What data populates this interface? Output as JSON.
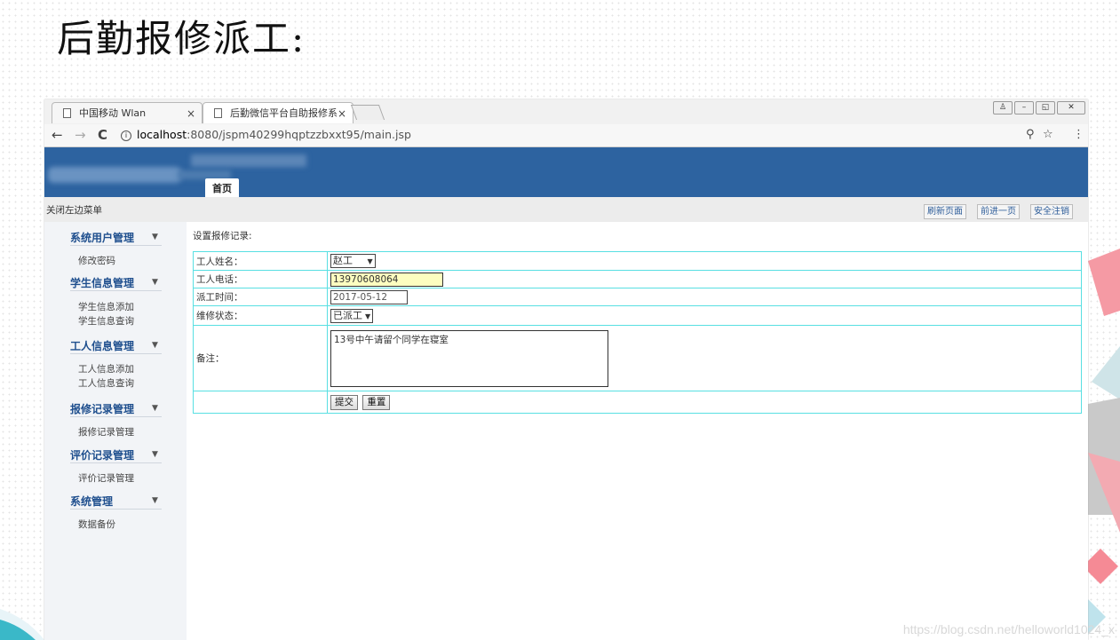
{
  "slide": {
    "title": "后勤报修派工:",
    "watermark": "https://blog.csdn.net/helloworld1024_x"
  },
  "browser": {
    "tabs": [
      {
        "label": "中国移动 Wlan",
        "close": "×"
      },
      {
        "label": "后勤微信平台自助报修系",
        "close": "×"
      }
    ],
    "window_buttons": [
      "♙",
      "–",
      "◱",
      "✕"
    ],
    "nav": {
      "back": "←",
      "forward": "→",
      "reload": "C"
    },
    "url_host": "localhost",
    "url_path": ":8080/jspm40299hqptzzbxxt95/main.jsp",
    "address_icons": {
      "key": "⚲",
      "star": "☆",
      "menu": "⋮"
    }
  },
  "app": {
    "home_tab": "首页",
    "collapse_menu": "关闭左边菜单",
    "toolbar_buttons": [
      "刷新页面",
      "前进一页",
      "安全注销"
    ],
    "sidebar": [
      {
        "group": "系统用户管理",
        "items": [
          "修改密码"
        ]
      },
      {
        "group": "学生信息管理",
        "items": [
          "学生信息添加",
          "学生信息查询"
        ]
      },
      {
        "group": "工人信息管理",
        "items": [
          "工人信息添加",
          "工人信息查询"
        ]
      },
      {
        "group": "报修记录管理",
        "items": [
          "报修记录管理"
        ]
      },
      {
        "group": "评价记录管理",
        "items": [
          "评价记录管理"
        ]
      },
      {
        "group": "系统管理",
        "items": [
          "数据备份"
        ]
      }
    ],
    "form": {
      "title": "设置报修记录:",
      "worker_name_label": "工人姓名：",
      "worker_name_value": "赵工",
      "worker_phone_label": "工人电话：",
      "worker_phone_value": "13970608064",
      "dispatch_time_label": "派工时间：",
      "dispatch_time_value": "2017-05-12",
      "status_label": "维修状态：",
      "status_value": "已派工",
      "remark_label": "备注：",
      "remark_value": "13号中午请留个同学在寝室",
      "submit_label": "提交",
      "reset_label": "重置"
    }
  },
  "colors": {
    "header": "#2d63a0",
    "table_border": "#58dfe2",
    "sidebar_group": "#1f4f8e",
    "phone_field": "#fefec0"
  }
}
